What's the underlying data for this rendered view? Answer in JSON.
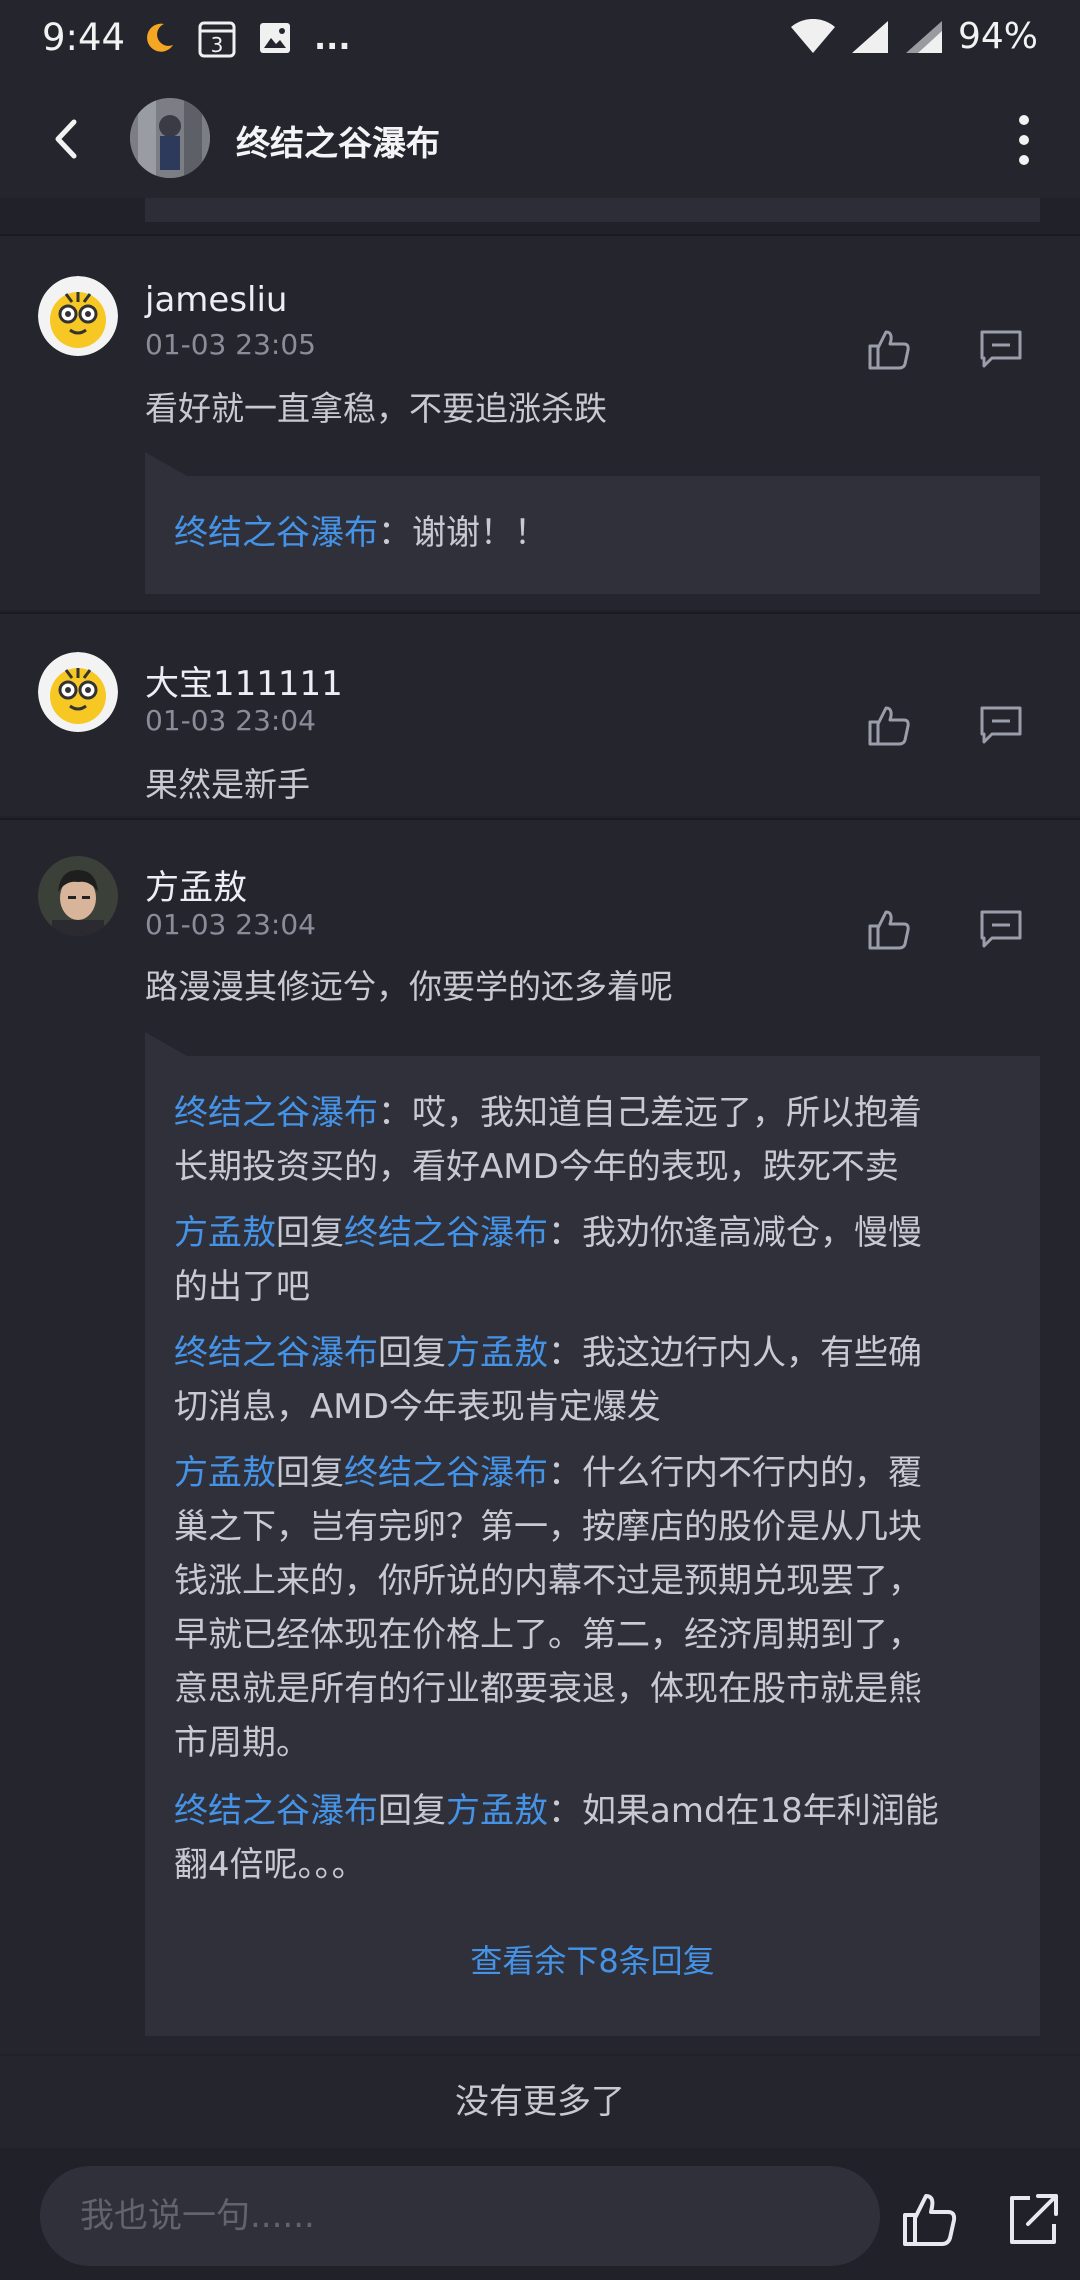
{
  "status_bar": {
    "time": "9:44",
    "battery": "94%",
    "calendar_day": "3",
    "more": "...",
    "icons": [
      "moon-icon",
      "calendar-icon",
      "image-icon",
      "wifi-icon",
      "signal-icon",
      "signal-icon-2"
    ]
  },
  "header": {
    "title": "终结之谷瀑布",
    "icons": [
      "back-icon",
      "more-vertical-icon"
    ]
  },
  "comments": [
    {
      "name": "jamesliu",
      "time": "01-03 23:05",
      "text": "看好就一直拿稳，不要追涨杀跌",
      "replies": [
        {
          "author": "终结之谷瀑布",
          "sep": "：",
          "text": "谢谢！！"
        }
      ]
    },
    {
      "name": "大宝111111",
      "time": "01-03 23:04",
      "text": "果然是新手"
    },
    {
      "name": "方孟敖",
      "time": "01-03 23:04",
      "text": "路漫漫其修远兮，你要学的还多着呢",
      "replies": [
        {
          "author": "终结之谷瀑布",
          "sep": "：",
          "text": "哎，我知道自己差远了，所以抱着",
          "text2": "长期投资买的，看好AMD今年的表现，跌死不卖"
        },
        {
          "author": "方孟敖",
          "mid": "回复",
          "target": "终结之谷瀑布",
          "sep": "：",
          "text": "我劝你逢高减仓，慢慢",
          "text2": "的出了吧"
        },
        {
          "author": "终结之谷瀑布",
          "mid": "回复",
          "target": "方孟敖",
          "sep": "：",
          "text": "我这边行内人，有些确",
          "text2": "切消息，AMD今年表现肯定爆发"
        },
        {
          "author": "方孟敖",
          "mid": "回复",
          "target": "终结之谷瀑布",
          "sep": "：",
          "text": "什么行内不行内的，覆",
          "lines": [
            "巢之下，岂有完卵？第一，按摩店的股价是从几块",
            "钱涨上来的，你所说的内幕不过是预期兑现罢了，",
            "早就已经体现在价格上了。第二，经济周期到了，",
            "意思就是所有的行业都要衰退，体现在股市就是熊",
            "市周期。"
          ]
        },
        {
          "author": "终结之谷瀑布",
          "mid": "回复",
          "target": "方孟敖",
          "sep": "：",
          "text": "如果amd在18年利润能",
          "text2": "翻4倍呢。。。"
        }
      ],
      "more_replies": "查看余下8条回复"
    }
  ],
  "no_more": "没有更多了",
  "input": {
    "placeholder": "我也说一句......"
  },
  "colors": {
    "background": "#202129",
    "card": "#24252d",
    "reply_box": "#2f303a",
    "accent_blue": "#4593e6"
  }
}
